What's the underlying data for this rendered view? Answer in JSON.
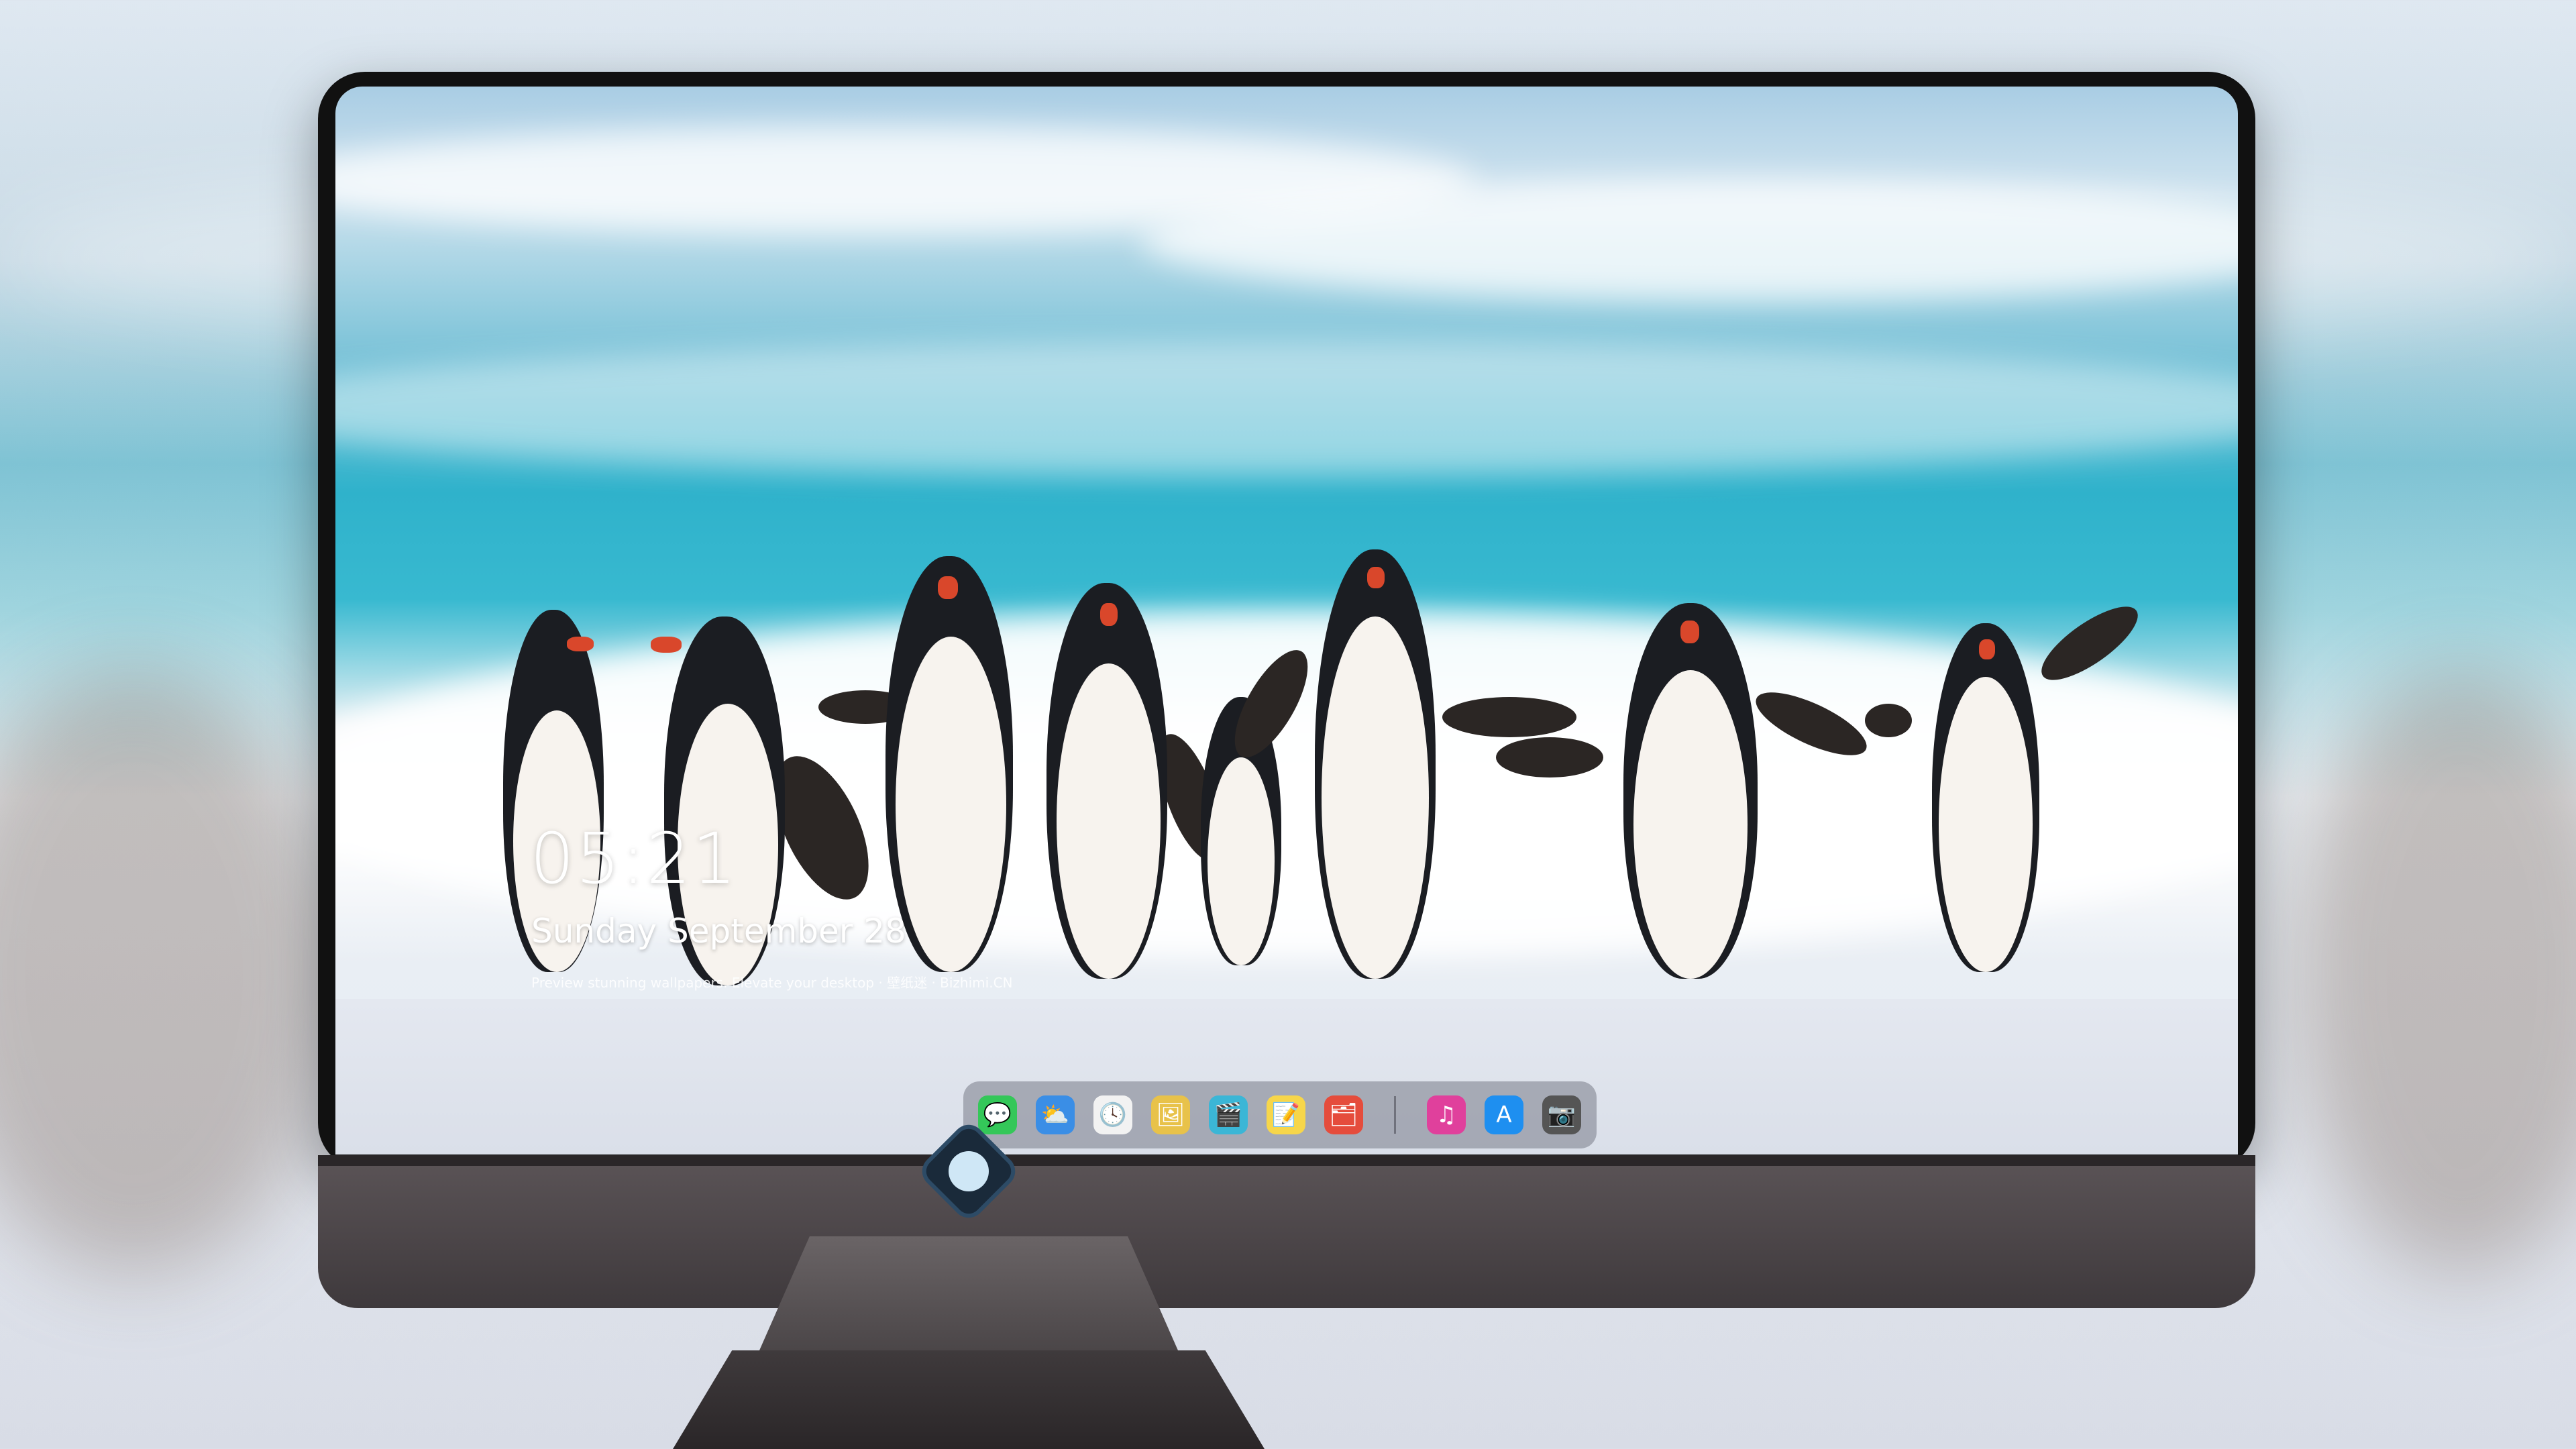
{
  "lockscreen": {
    "time": "05:21",
    "date": "Sunday September 28",
    "caption": "Preview stunning wallpapers. Elevate your desktop · 壁纸迷 · Bizhimi.CN"
  },
  "dock": {
    "apps": [
      {
        "name": "Messages",
        "icon": "message-icon",
        "color": "#34c759",
        "glyph": "💬"
      },
      {
        "name": "Weather",
        "icon": "weather-icon",
        "color": "#3a8ee6",
        "glyph": "⛅"
      },
      {
        "name": "Clock",
        "icon": "clock-icon",
        "color": "#f2f2f2",
        "glyph": "🕓"
      },
      {
        "name": "Preview",
        "icon": "preview-icon",
        "color": "#e8c24a",
        "glyph": "🖼"
      },
      {
        "name": "Video Editor",
        "icon": "clapper-icon",
        "color": "#3bb6d6",
        "glyph": "🎬"
      },
      {
        "name": "Notes",
        "icon": "notes-icon",
        "color": "#f7d64a",
        "glyph": "📝"
      },
      {
        "name": "Photos",
        "icon": "photos-icon",
        "color": "#e54c3c",
        "glyph": "🗂"
      },
      {
        "name": "Music",
        "icon": "music-icon",
        "color": "#e0409c",
        "glyph": "♫"
      },
      {
        "name": "App Store",
        "icon": "app-store-icon",
        "color": "#1e8ff0",
        "glyph": "A"
      },
      {
        "name": "Camera",
        "icon": "camera-icon",
        "color": "#555555",
        "glyph": "📷"
      }
    ]
  }
}
